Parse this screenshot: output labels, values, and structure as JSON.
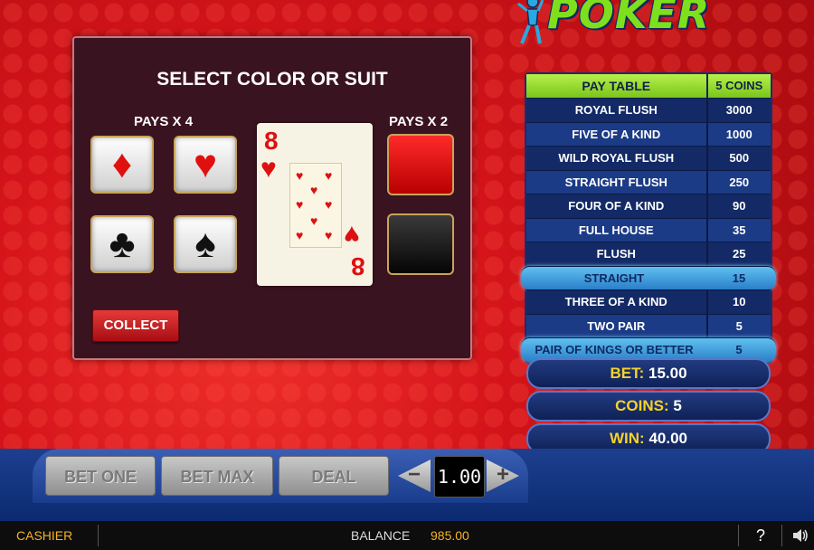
{
  "logo": {
    "text": "POKER",
    "icon": "joker-figure-icon"
  },
  "gamble": {
    "title": "SELECT COLOR OR SUIT",
    "pays_suit": "PAYS X 4",
    "pays_color": "PAYS X 2",
    "suits": [
      {
        "symbol": "♦",
        "color": "#e01010",
        "icon": "diamond-icon"
      },
      {
        "symbol": "♥",
        "color": "#e01010",
        "icon": "heart-icon"
      },
      {
        "symbol": "♣",
        "color": "#111111",
        "icon": "club-icon"
      },
      {
        "symbol": "♠",
        "color": "#111111",
        "icon": "spade-icon"
      }
    ],
    "colors": [
      {
        "name": "red",
        "fill": "#e01010"
      },
      {
        "name": "black",
        "fill": "#111111"
      }
    ],
    "card": {
      "rank": "8",
      "suit": "♥"
    },
    "collect_label": "COLLECT"
  },
  "paytable": {
    "header_name": "PAY TABLE",
    "header_coins": "5 COINS",
    "rows": [
      {
        "name": "ROYAL FLUSH",
        "value": "3000",
        "highlight": false
      },
      {
        "name": "FIVE OF A KIND",
        "value": "1000",
        "highlight": false
      },
      {
        "name": "WILD ROYAL FLUSH",
        "value": "500",
        "highlight": false
      },
      {
        "name": "STRAIGHT FLUSH",
        "value": "250",
        "highlight": false
      },
      {
        "name": "FOUR OF A KIND",
        "value": "90",
        "highlight": false
      },
      {
        "name": "FULL HOUSE",
        "value": "35",
        "highlight": false
      },
      {
        "name": "FLUSH",
        "value": "25",
        "highlight": false
      },
      {
        "name": "STRAIGHT",
        "value": "15",
        "highlight": true
      },
      {
        "name": "THREE OF A KIND",
        "value": "10",
        "highlight": false
      },
      {
        "name": "TWO PAIR",
        "value": "5",
        "highlight": false
      },
      {
        "name": "PAIR OF KINGS OR BETTER",
        "value": "5",
        "highlight": true
      }
    ]
  },
  "info": {
    "bet_label": "BET:",
    "bet_value": "15.00",
    "coins_label": "COINS:",
    "coins_value": "5",
    "win_label": "WIN:",
    "win_value": "40.00"
  },
  "controls": {
    "bet_one": "BET ONE",
    "bet_max": "BET MAX",
    "deal": "DEAL",
    "minus": "−",
    "plus": "+",
    "denomination": "1.00"
  },
  "status": {
    "cashier": "CASHIER",
    "balance_label": "BALANCE",
    "balance_value": "985.00",
    "help": "?"
  }
}
